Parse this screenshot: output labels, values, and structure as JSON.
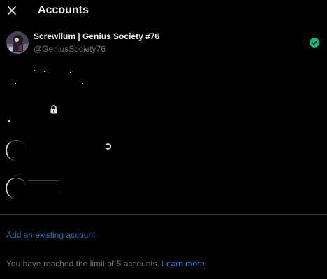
{
  "header": {
    "title": "Accounts",
    "close_icon": "close-icon"
  },
  "active_account": {
    "name": "Screwllum | Genius Society #76",
    "handle": "@GeniusSociety76",
    "status_icon": "check-circle-icon",
    "status_color": "#00ba7c"
  },
  "footer": {
    "add_account_label": "Add an existing account",
    "limit_text": "You have reached the limit of 5 accounts.",
    "learn_more_label": "Learn more"
  },
  "colors": {
    "background": "#000000",
    "text_primary": "#e7e9ea",
    "text_secondary": "#71767b",
    "link": "#1d9bf0",
    "divider": "#2f3336"
  }
}
